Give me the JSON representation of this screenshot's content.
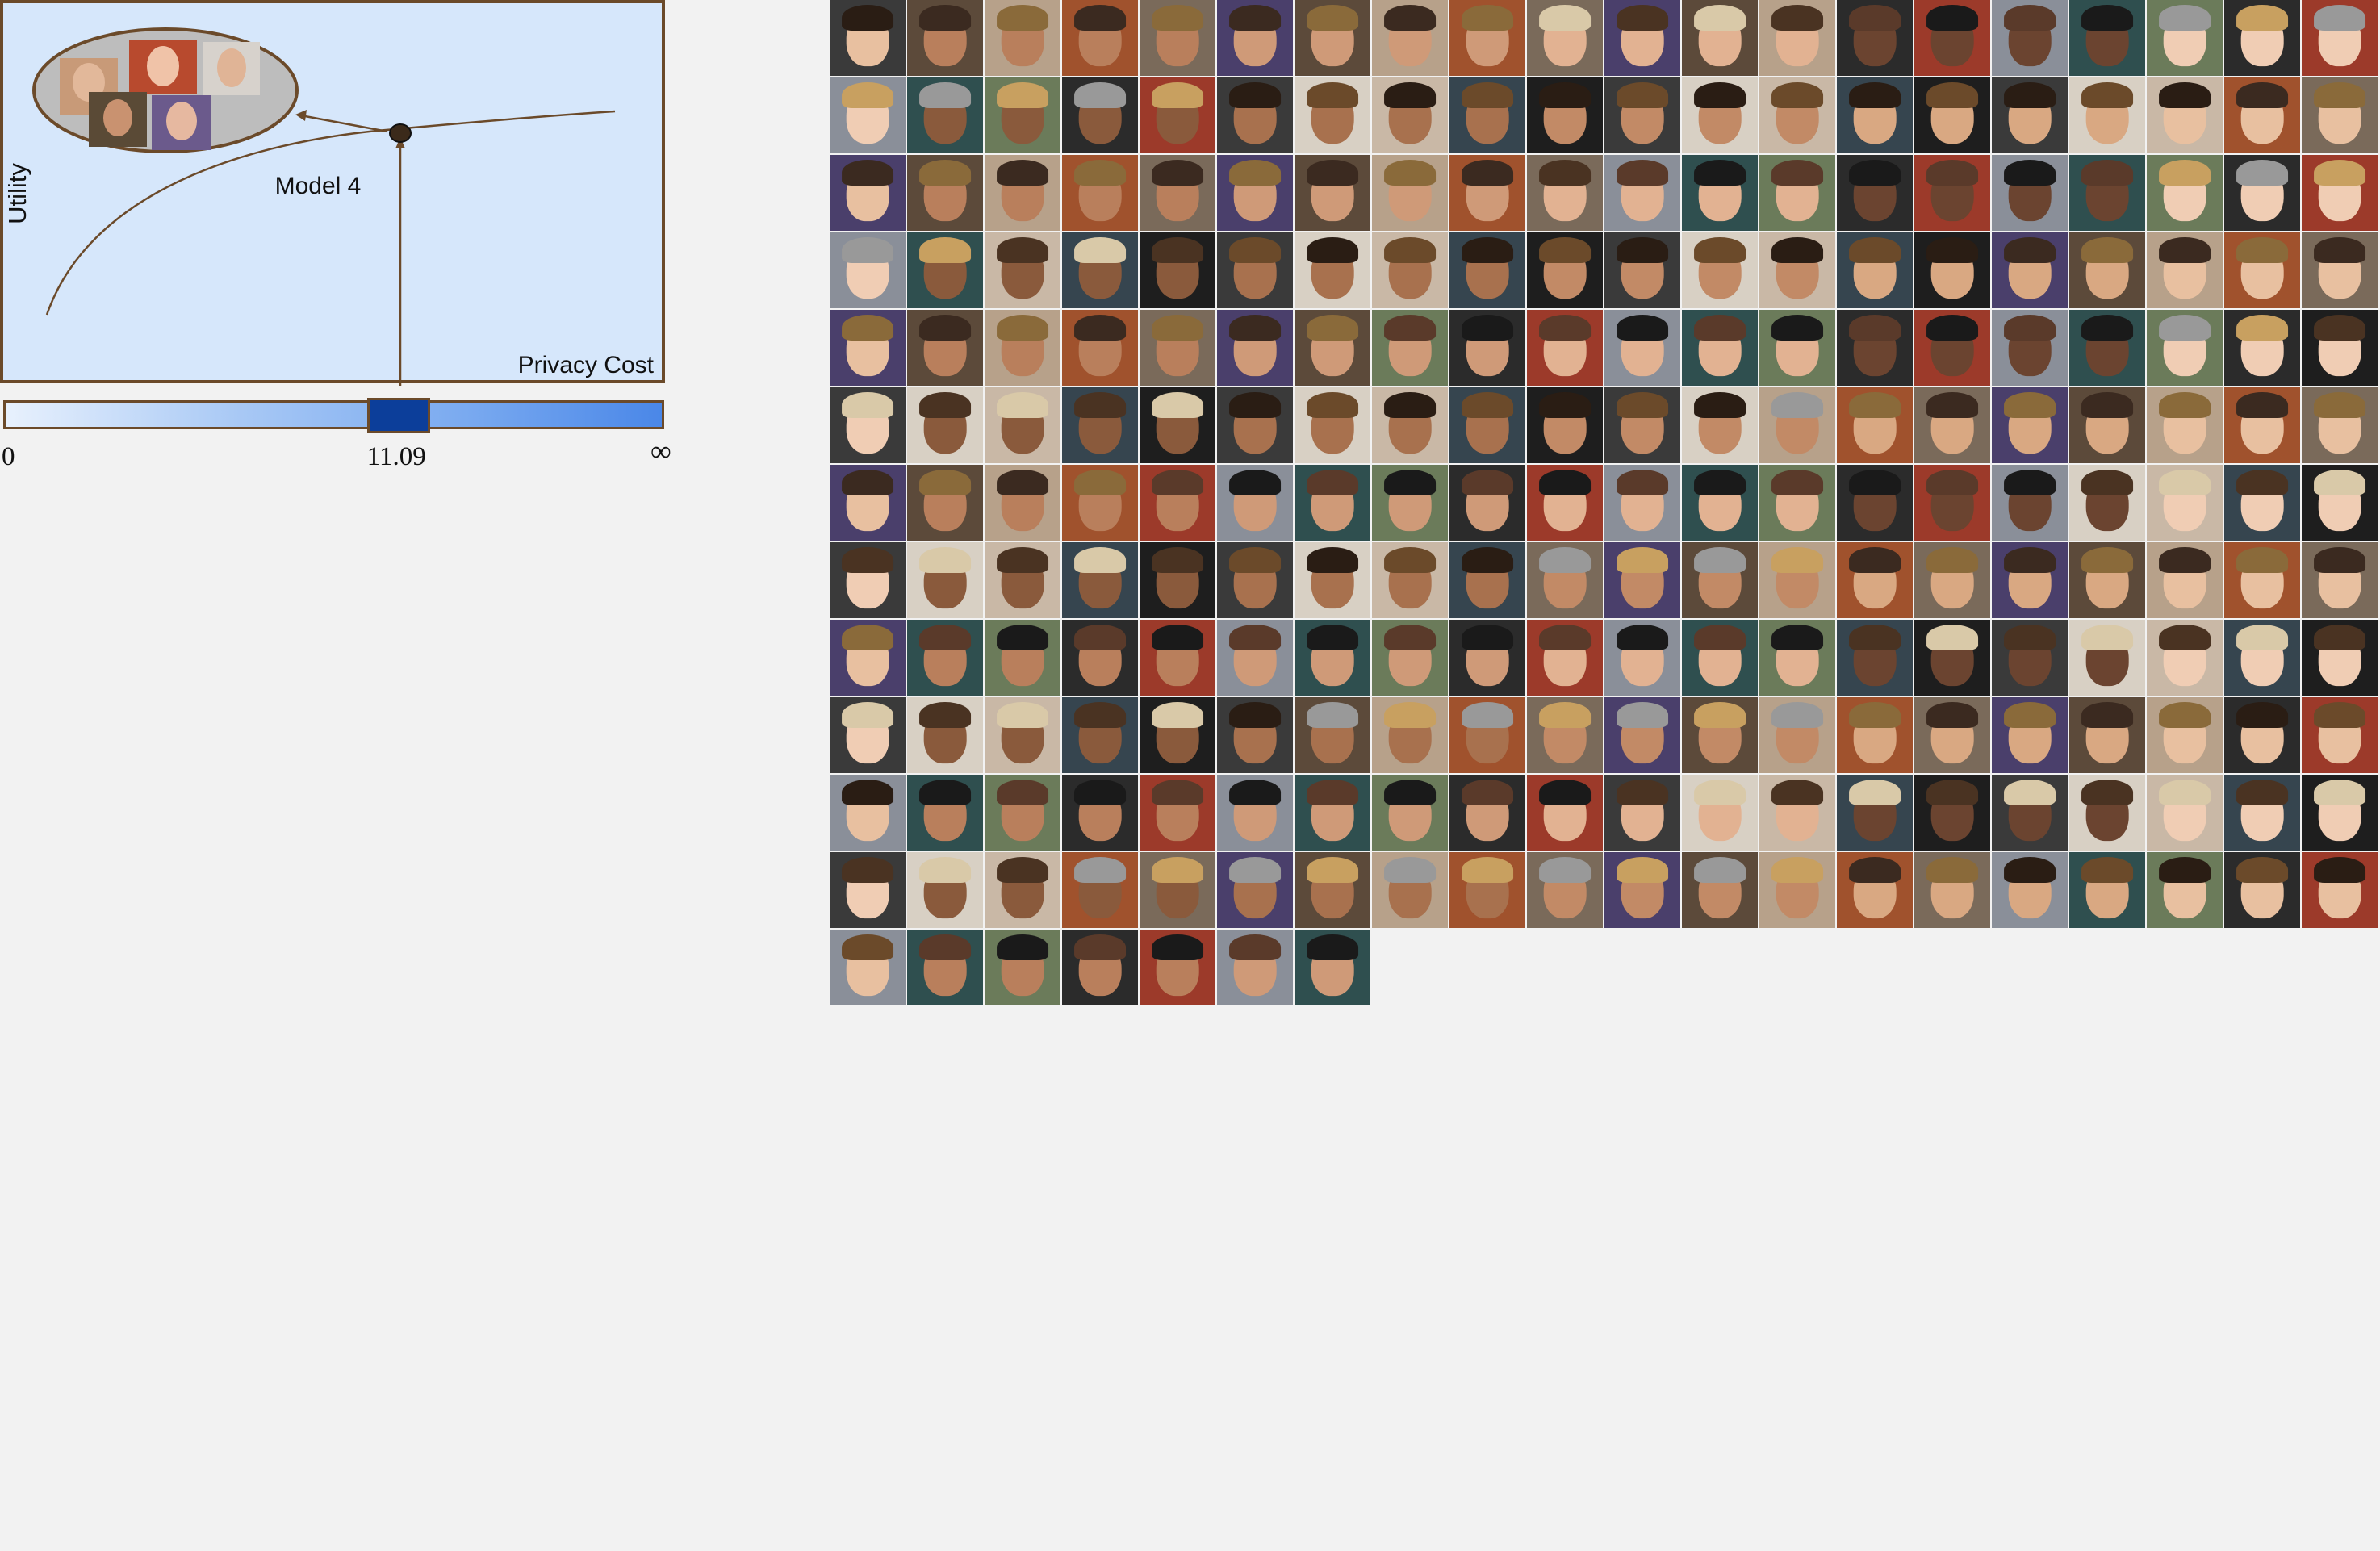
{
  "chart": {
    "y_axis_label": "Utility",
    "x_axis_label": "Privacy Cost",
    "model_label": "Model 4"
  },
  "slider": {
    "min_label": "0",
    "value_label": "11.09",
    "max_label": "∞",
    "thumb_fraction": 0.595
  },
  "colors": {
    "page_background": "#f2f2f2",
    "chart_background": "#d6e7fb",
    "outline": "#6b4a2a",
    "slider_thumb": "#0c3e9a",
    "slider_gradient_end": "#4a87e8"
  },
  "face_grid": {
    "columns": 20,
    "rows": 13,
    "tiles": 247
  }
}
